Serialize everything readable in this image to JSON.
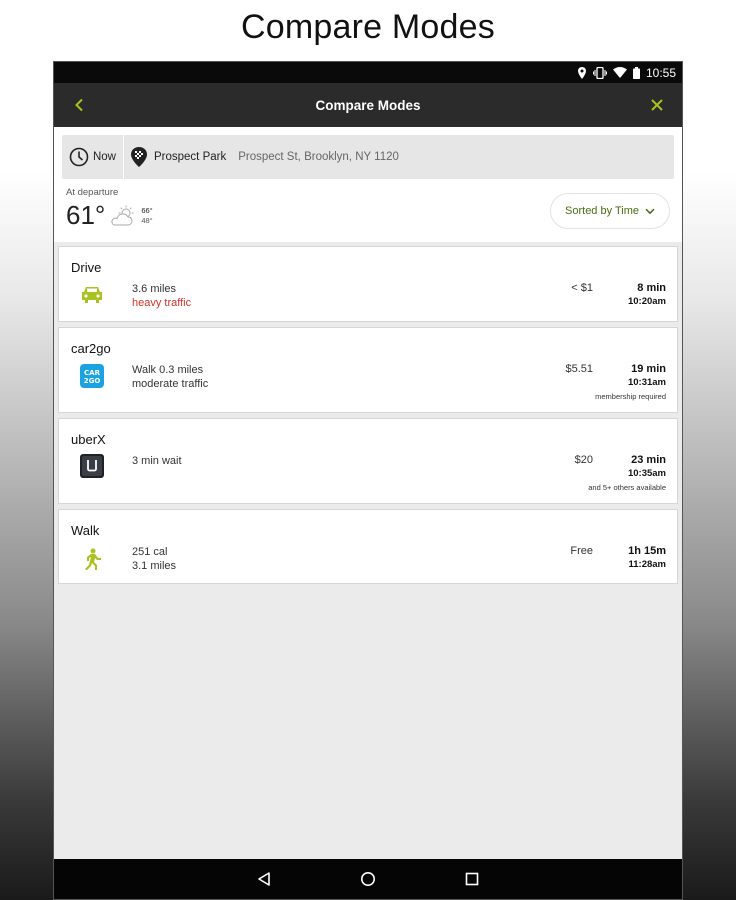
{
  "promo": {
    "title": "Compare Modes"
  },
  "status_bar": {
    "time": "10:55",
    "icons": [
      "location-icon",
      "vibrate-icon",
      "wifi-icon",
      "battery-icon"
    ]
  },
  "app_bar": {
    "title": "Compare Modes",
    "back_icon": "chevron-left-icon",
    "close_icon": "close-icon"
  },
  "search": {
    "time_label": "Now",
    "destination_name": "Prospect Park",
    "destination_address": "Prospect St, Brooklyn, NY 1120"
  },
  "weather": {
    "label": "At departure",
    "temperature": "61°",
    "high": "66°",
    "low": "48°",
    "condition_icon": "partly-cloudy-icon"
  },
  "sort": {
    "label": "Sorted by Time"
  },
  "modes": [
    {
      "name": "Drive",
      "icon": "car-icon",
      "detail1": "3.6 miles",
      "detail2": "heavy traffic",
      "cost": "< $1",
      "duration": "8 min",
      "arrival": "10:20am",
      "note": ""
    },
    {
      "name": "car2go",
      "icon": "car2go-icon",
      "detail1": "Walk 0.3 miles",
      "detail2": "moderate traffic",
      "cost": "$5.51",
      "duration": "19 min",
      "arrival": "10:31am",
      "note": "membership required"
    },
    {
      "name": "uberX",
      "icon": "uber-icon",
      "detail1": "3 min wait",
      "detail2": "",
      "cost": "$20",
      "duration": "23 min",
      "arrival": "10:35am",
      "note": "and 5+ others available"
    },
    {
      "name": "Walk",
      "icon": "walk-icon",
      "detail1": "251 cal",
      "detail2": "3.1 miles",
      "cost": "Free",
      "duration": "1h 15m",
      "arrival": "11:28am",
      "note": ""
    }
  ],
  "colors": {
    "accent": "#a6c31f",
    "warning": "#d0342c",
    "app_bar": "#2b2b2b",
    "car2go": "#1aa3e0"
  },
  "nav_bar": {
    "icons": [
      "back-triangle-icon",
      "home-circle-icon",
      "recents-square-icon"
    ]
  }
}
